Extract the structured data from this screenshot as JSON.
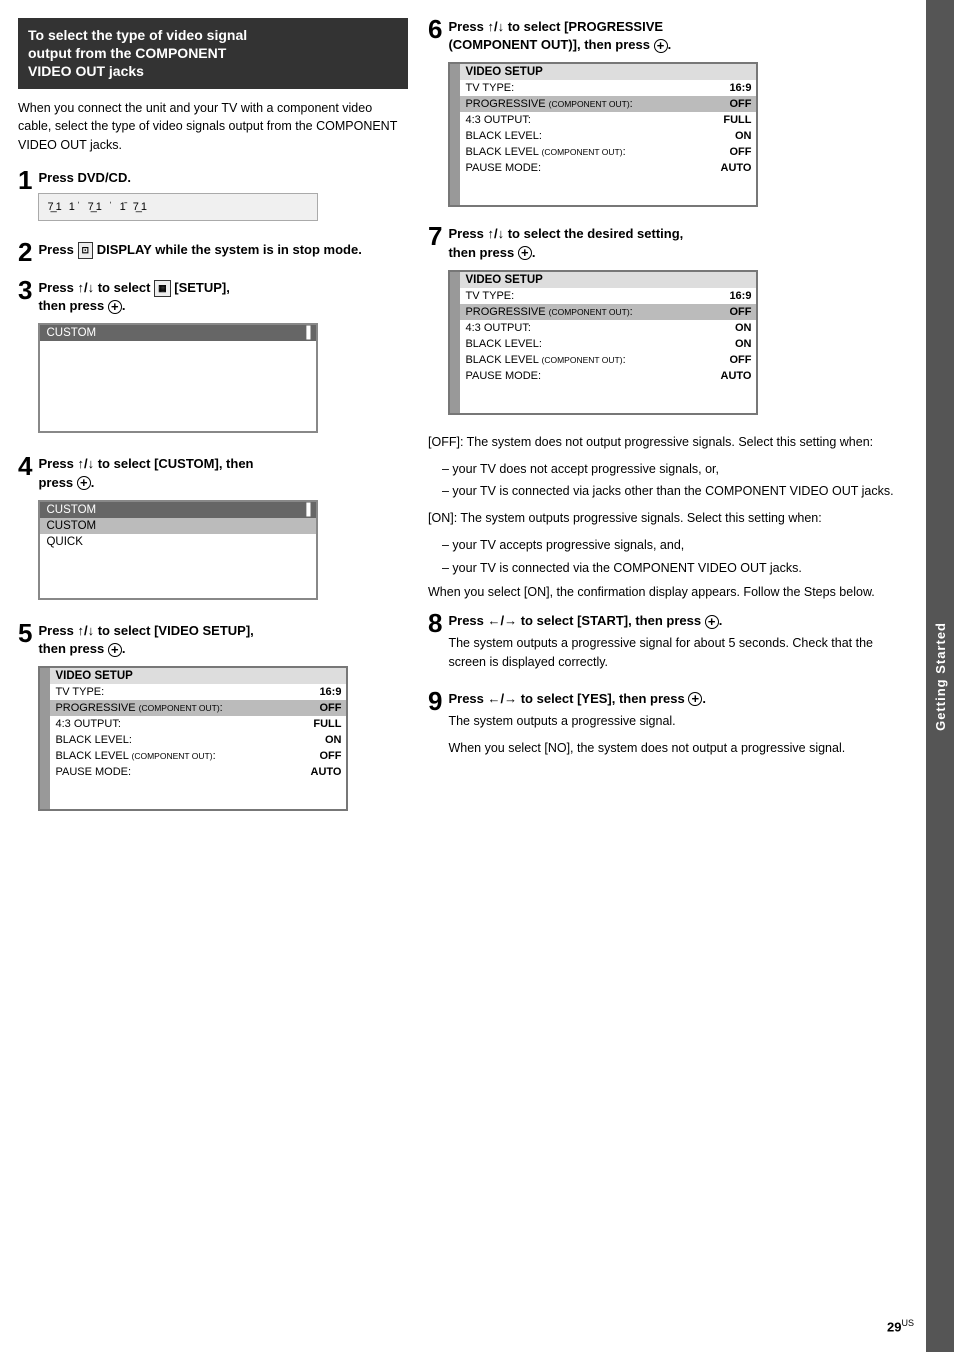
{
  "side_tab": {
    "label": "Getting Started"
  },
  "section_header": {
    "line1": "To select the type of video signal",
    "line2": "output from the COMPONENT",
    "line3": "VIDEO OUT jacks"
  },
  "intro_text": "When you connect the unit and your TV with a component video cable, select the type of video signals output from the COMPONENT VIDEO OUT jacks.",
  "steps": {
    "step1": {
      "number": "1",
      "label": "Press DVD/CD."
    },
    "step2": {
      "number": "2",
      "label": "Press",
      "icon": "DISPLAY",
      "label2": "DISPLAY while the system is in stop mode."
    },
    "step3": {
      "number": "3",
      "label": "Press ↑/↓ to select",
      "icon_text": "[SETUP],",
      "label2": "then press",
      "circle": "+"
    },
    "step4": {
      "number": "4",
      "label": "Press ↑/↓ to select [CUSTOM], then press",
      "circle": "+"
    },
    "step5": {
      "number": "5",
      "label": "Press ↑/↓ to select [VIDEO SETUP], then press",
      "circle": "+"
    },
    "step6": {
      "number": "6",
      "label": "Press ↑/↓ to select [PROGRESSIVE (COMPONENT OUT)], then press",
      "circle": "+"
    },
    "step7": {
      "number": "7",
      "label": "Press ↑/↓ to select the desired setting, then press",
      "circle": "+"
    },
    "step8": {
      "number": "8",
      "label": "Press ←/→ to select [START], then press",
      "circle": "+"
    },
    "step9": {
      "number": "9",
      "label": "Press ←/→ to select [YES], then press",
      "circle": "+"
    }
  },
  "menu_custom": {
    "header": "CUSTOM",
    "scroll_indicator": "▐"
  },
  "menu_custom_expanded": {
    "header": "CUSTOM",
    "items": [
      "CUSTOM",
      "QUICK"
    ],
    "selected": "CUSTOM",
    "scroll_indicator": "▐"
  },
  "video_setup_menu1": {
    "title": "VIDEO SETUP",
    "rows": [
      {
        "label": "TV TYPE:",
        "value": "16:9"
      },
      {
        "label": "PROGRESSIVE (COMPONENT OUT):",
        "value": "OFF",
        "small": true,
        "highlighted": true
      },
      {
        "label": "4:3 OUTPUT:",
        "value": "FULL"
      },
      {
        "label": "BLACK LEVEL:",
        "value": "ON"
      },
      {
        "label": "BLACK LEVEL (COMPONENT OUT):",
        "value": "OFF",
        "small": true
      },
      {
        "label": "PAUSE MODE:",
        "value": "AUTO"
      }
    ]
  },
  "video_setup_menu2": {
    "title": "VIDEO SETUP",
    "rows": [
      {
        "label": "TV TYPE:",
        "value": "16:9"
      },
      {
        "label": "PROGRESSIVE (COMPONENT OUT):",
        "value": "OFF",
        "small": true,
        "highlighted": true
      },
      {
        "label": "4:3 OUTPUT:",
        "value": "ON"
      },
      {
        "label": "BLACK LEVEL:",
        "value": "ON"
      },
      {
        "label": "BLACK LEVEL (COMPONENT OUT):",
        "value": "OFF",
        "small": true
      },
      {
        "label": "PAUSE MODE:",
        "value": "AUTO"
      }
    ]
  },
  "off_text": "[OFF]: The system does not output progressive signals. Select this setting when:",
  "off_bullets": [
    "your TV does not accept progressive signals, or,",
    "your TV is connected via jacks other than the COMPONENT VIDEO OUT jacks."
  ],
  "on_text": "[ON]: The system outputs progressive signals. Select this setting when:",
  "on_bullets": [
    "your TV accepts progressive signals, and,",
    "your TV is connected via the COMPONENT VIDEO OUT jacks."
  ],
  "on_note": "When you select [ON], the confirmation display appears. Follow the Steps below.",
  "step8_text": "The system outputs a progressive signal for about 5 seconds. Check that the screen is displayed correctly.",
  "step9_text1": "The system outputs a progressive signal.",
  "step9_text2": "When you select [NO], the system does not output a progressive signal.",
  "page_number": "29",
  "page_suffix": "US"
}
